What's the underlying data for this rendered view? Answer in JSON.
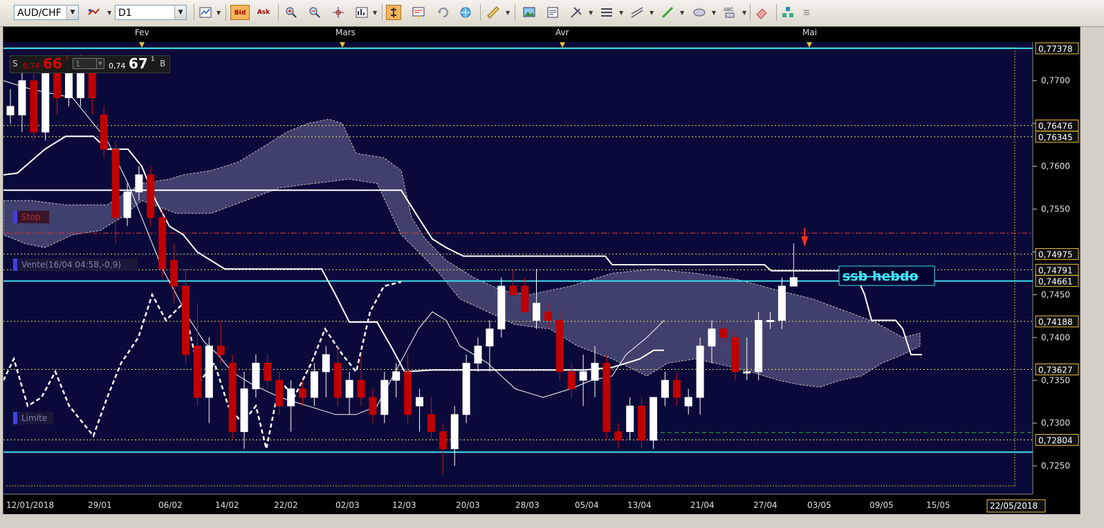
{
  "toolbar": {
    "symbol": "AUD/CHF",
    "timeframe": "D1",
    "bid_label": "Bid",
    "ask_label": "Ask",
    "buttons": [
      "line-chart-icon",
      "bid-button",
      "ask-button",
      "zoom-in-icon",
      "zoom-out-icon",
      "crosshair-icon",
      "indicator-icon",
      "cursor-icon",
      "template-icon",
      "refresh-icon",
      "globe-icon",
      "ruler-icon",
      "image-icon",
      "print-icon",
      "tools-icon",
      "lines-icon",
      "trendline-icon",
      "pencil-icon",
      "ellipse-icon",
      "text-icon",
      "eraser-icon",
      "objects-icon",
      "more-icon"
    ]
  },
  "trade_panel": {
    "sell_label": "S",
    "sell_prefix": "0,74",
    "sell_big": "66",
    "sell_sup": "7",
    "quantity": "1",
    "buy_prefix": "0,74",
    "buy_big": "67",
    "buy_sup": "1",
    "buy_label": "B"
  },
  "chart_data": {
    "type": "candlestick",
    "symbol": "AUD/CHF",
    "timeframe": "D1",
    "ylim": [
      0.7217,
      0.7745
    ],
    "y_ticks": [
      "0,7700",
      "0,7650",
      "0,7600",
      "0,7550",
      "0,7500",
      "0,7450",
      "0,7400",
      "0,7350",
      "0,7300",
      "0,7250"
    ],
    "x_labels": [
      "12/01/2018",
      "29/01",
      "06/02",
      "14/02",
      "22/02",
      "02/03",
      "12/03",
      "20/03",
      "28/03",
      "05/04",
      "13/04",
      "21/04",
      "27/04",
      "03/05",
      "09/05",
      "15/05",
      "22/05/2018"
    ],
    "months": [
      "Fev",
      "Mars",
      "Avr",
      "Mai"
    ],
    "levels": [
      {
        "value": 0.77378,
        "label": "0,77378",
        "style": "cyan"
      },
      {
        "value": 0.76476,
        "label": "0,76476",
        "style": "dotted"
      },
      {
        "value": 0.76345,
        "label": "0,76345",
        "style": "dotted"
      },
      {
        "value": 0.74975,
        "label": "0,74975",
        "style": "dotted"
      },
      {
        "value": 0.74791,
        "label": "0,74791",
        "style": "dotted"
      },
      {
        "value": 0.7466,
        "label": "0,74661",
        "style": "cyan"
      },
      {
        "value": 0.74188,
        "label": "0,74188",
        "style": "dotted"
      },
      {
        "value": 0.73627,
        "label": "0,73627",
        "style": "dotted"
      },
      {
        "value": 0.72804,
        "label": "0,72804",
        "style": "dotted"
      },
      {
        "value": 0.7266,
        "label": "",
        "style": "cyan"
      }
    ],
    "order_lines": [
      {
        "label": "Stop",
        "value": 0.7522
      },
      {
        "label": "Vente(16/04 04:58,-0,9)",
        "value": 0.7467
      },
      {
        "label": "Limite",
        "value": 0.7289
      }
    ],
    "annotation": "ssb hebdo",
    "candles": [
      [
        0.766,
        0.769,
        0.765,
        0.767
      ],
      [
        0.766,
        0.772,
        0.764,
        0.77
      ],
      [
        0.77,
        0.771,
        0.763,
        0.764
      ],
      [
        0.764,
        0.772,
        0.763,
        0.771
      ],
      [
        0.771,
        0.772,
        0.766,
        0.768
      ],
      [
        0.768,
        0.773,
        0.767,
        0.771
      ],
      [
        0.768,
        0.773,
        0.767,
        0.772
      ],
      [
        0.772,
        0.773,
        0.766,
        0.768
      ],
      [
        0.766,
        0.767,
        0.761,
        0.762
      ],
      [
        0.762,
        0.763,
        0.751,
        0.754
      ],
      [
        0.754,
        0.758,
        0.753,
        0.757
      ],
      [
        0.757,
        0.76,
        0.756,
        0.759
      ],
      [
        0.759,
        0.76,
        0.753,
        0.754
      ],
      [
        0.754,
        0.755,
        0.747,
        0.748
      ],
      [
        0.749,
        0.751,
        0.744,
        0.746
      ],
      [
        0.746,
        0.748,
        0.737,
        0.738
      ],
      [
        0.739,
        0.744,
        0.732,
        0.733
      ],
      [
        0.733,
        0.74,
        0.73,
        0.739
      ],
      [
        0.739,
        0.742,
        0.737,
        0.738
      ],
      [
        0.737,
        0.738,
        0.728,
        0.729
      ],
      [
        0.729,
        0.736,
        0.727,
        0.734
      ],
      [
        0.734,
        0.738,
        0.733,
        0.737
      ],
      [
        0.737,
        0.738,
        0.734,
        0.735
      ],
      [
        0.735,
        0.736,
        0.731,
        0.732
      ],
      [
        0.732,
        0.735,
        0.729,
        0.734
      ],
      [
        0.734,
        0.735,
        0.732,
        0.733
      ],
      [
        0.733,
        0.737,
        0.732,
        0.736
      ],
      [
        0.736,
        0.739,
        0.733,
        0.738
      ],
      [
        0.737,
        0.739,
        0.732,
        0.733
      ],
      [
        0.733,
        0.736,
        0.731,
        0.735
      ],
      [
        0.735,
        0.738,
        0.732,
        0.733
      ],
      [
        0.733,
        0.734,
        0.73,
        0.731
      ],
      [
        0.731,
        0.736,
        0.73,
        0.735
      ],
      [
        0.735,
        0.737,
        0.733,
        0.736
      ],
      [
        0.736,
        0.738,
        0.73,
        0.731
      ],
      [
        0.732,
        0.734,
        0.729,
        0.733
      ],
      [
        0.731,
        0.733,
        0.728,
        0.729
      ],
      [
        0.729,
        0.73,
        0.724,
        0.727
      ],
      [
        0.727,
        0.732,
        0.725,
        0.731
      ],
      [
        0.731,
        0.738,
        0.73,
        0.737
      ],
      [
        0.737,
        0.74,
        0.736,
        0.739
      ],
      [
        0.739,
        0.742,
        0.736,
        0.741
      ],
      [
        0.741,
        0.747,
        0.74,
        0.746
      ],
      [
        0.746,
        0.748,
        0.745,
        0.745
      ],
      [
        0.746,
        0.747,
        0.743,
        0.743
      ],
      [
        0.742,
        0.748,
        0.741,
        0.744
      ],
      [
        0.743,
        0.744,
        0.741,
        0.742
      ],
      [
        0.742,
        0.743,
        0.735,
        0.736
      ],
      [
        0.736,
        0.737,
        0.733,
        0.734
      ],
      [
        0.735,
        0.738,
        0.732,
        0.736
      ],
      [
        0.735,
        0.739,
        0.733,
        0.737
      ],
      [
        0.737,
        0.738,
        0.728,
        0.729
      ],
      [
        0.729,
        0.73,
        0.727,
        0.728
      ],
      [
        0.729,
        0.733,
        0.728,
        0.732
      ],
      [
        0.732,
        0.733,
        0.727,
        0.728
      ],
      [
        0.728,
        0.733,
        0.727,
        0.733
      ],
      [
        0.733,
        0.736,
        0.732,
        0.735
      ],
      [
        0.735,
        0.736,
        0.732,
        0.733
      ],
      [
        0.732,
        0.734,
        0.731,
        0.733
      ],
      [
        0.733,
        0.74,
        0.731,
        0.739
      ],
      [
        0.739,
        0.742,
        0.737,
        0.741
      ],
      [
        0.741,
        0.742,
        0.739,
        0.74
      ],
      [
        0.74,
        0.741,
        0.735,
        0.736
      ],
      [
        0.736,
        0.74,
        0.735,
        0.736
      ],
      [
        0.736,
        0.743,
        0.735,
        0.742
      ],
      [
        0.742,
        0.743,
        0.741,
        0.742
      ],
      [
        0.742,
        0.747,
        0.741,
        0.746
      ],
      [
        0.746,
        0.751,
        0.746,
        0.747
      ]
    ]
  }
}
